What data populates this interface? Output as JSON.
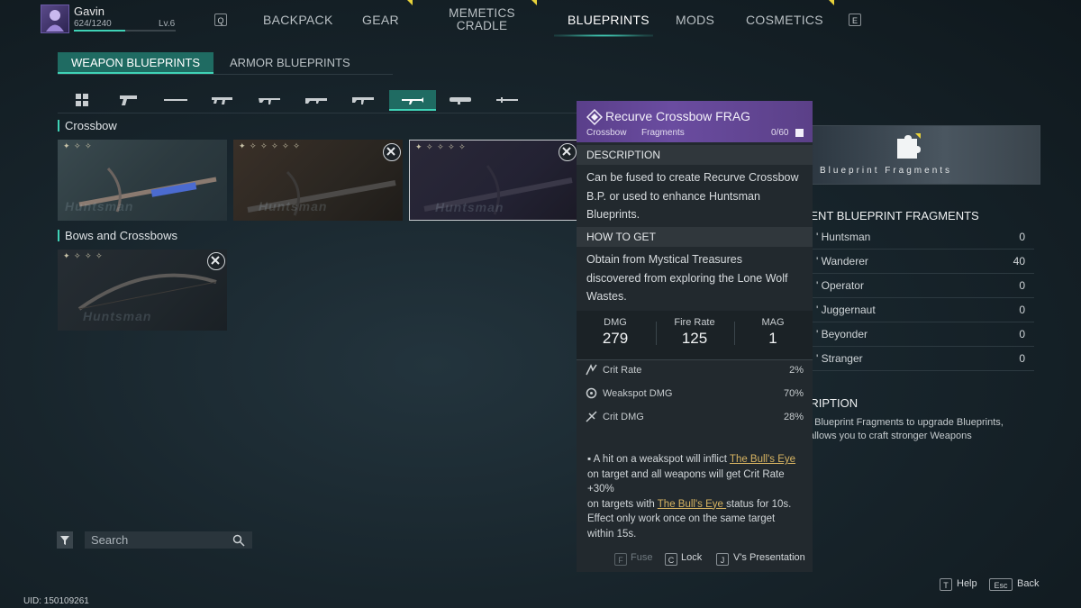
{
  "player": {
    "name": "Gavin",
    "xp": "624/1240",
    "level": "Lv.6",
    "xp_fraction": 0.5
  },
  "nav": {
    "left_key": "Q",
    "right_key": "E",
    "items": [
      "BACKPACK",
      "GEAR",
      "MEMETICS",
      "CRADLE",
      "BLUEPRINTS",
      "MODS",
      "COSMETICS"
    ],
    "accent": "#46e0c6",
    "notify_color": "#e8d23a"
  },
  "tabs": {
    "weapon": "WEAPON BLUEPRINTS",
    "armor": "ARMOR BLUEPRINTS"
  },
  "weapon_icons": [
    "grid-icon",
    "pistol-icon",
    "sniper-icon",
    "smg-icon",
    "rifle-icon",
    "lmg-icon",
    "shotgun-icon",
    "crossbow-icon",
    "launcher-icon",
    "melee-icon"
  ],
  "sections": [
    {
      "title": "Crossbow",
      "cards": [
        "Huntsman",
        "Huntsman",
        "Huntsman"
      ]
    },
    {
      "title": "Bows and Crossbows",
      "cards": [
        "Huntsman"
      ]
    }
  ],
  "search": {
    "placeholder": "Search"
  },
  "uid": "UID: 150109261",
  "fragments_panel": {
    "image_label": "Blueprint Fragments",
    "heading": "RENT BLUEPRINT FRAGMENTS",
    "rows": [
      {
        "name": "' Huntsman",
        "value": "0"
      },
      {
        "name": "' Wanderer",
        "value": "40"
      },
      {
        "name": "' Operator",
        "value": "0"
      },
      {
        "name": "' Juggernaut",
        "value": "0"
      },
      {
        "name": "' Beyonder",
        "value": "0"
      },
      {
        "name": "' Stranger",
        "value": "0"
      }
    ],
    "desc_heading": "CRIPTION",
    "desc_line1": "t Blueprint Fragments to upgrade Blueprints,",
    "desc_line2": "allows you to craft stronger Weapons"
  },
  "tooltip": {
    "title": "Recurve Crossbow FRAG",
    "type": "Crossbow",
    "category": "Fragments",
    "count": "0/60",
    "description_heading": "DESCRIPTION",
    "description_lines": [
      "Can be fused to create Recurve Crossbow",
      "B.P. or used to enhance Huntsman",
      "Blueprints."
    ],
    "howto_heading": "HOW TO GET",
    "howto_lines": [
      "Obtain from Mystical Treasures",
      "discovered from exploring the Lone Wolf",
      "Wastes."
    ],
    "stats": [
      {
        "label": "DMG",
        "value": "279"
      },
      {
        "label": "Fire Rate",
        "value": "125"
      },
      {
        "label": "MAG",
        "value": "1"
      }
    ],
    "substats": [
      {
        "name": "Crit Rate",
        "value": "2%"
      },
      {
        "name": "Weakspot DMG",
        "value": "70%"
      },
      {
        "name": "Crit DMG",
        "value": "28%"
      }
    ],
    "effect": {
      "l1a": "▪ A hit on a weakspot will inflict ",
      "link": "The Bull's Eye ",
      "l2": "on target and all weapons will get Crit Rate",
      "l3": "+30%",
      "l4a": "on targets with ",
      "l4b": " status for 10s.",
      "l5": "Effect only work once on the same target",
      "l6": "within 15s."
    },
    "footer": [
      {
        "key": "F",
        "label": "Fuse"
      },
      {
        "key": "C",
        "label": "Lock"
      },
      {
        "key": "J",
        "label": "V's Presentation"
      }
    ]
  },
  "bottom": [
    {
      "key": "T",
      "label": "Help"
    },
    {
      "key": "Esc",
      "label": "Back"
    }
  ]
}
